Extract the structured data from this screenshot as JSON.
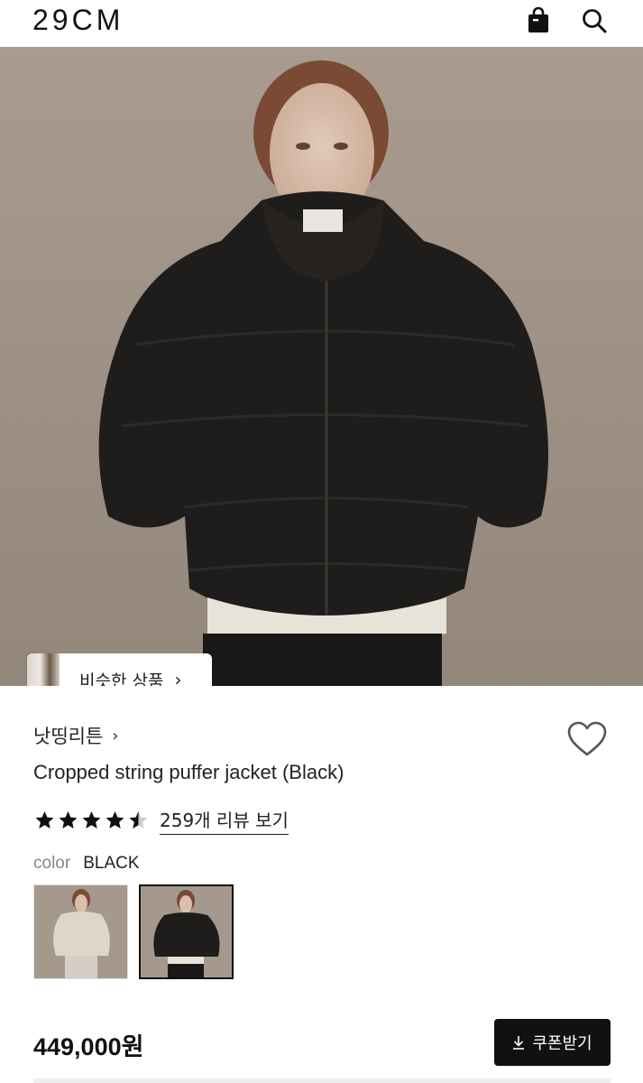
{
  "header": {
    "logo": "29CM",
    "icons": [
      "shopping-bag-icon",
      "search-icon"
    ]
  },
  "hero": {
    "similar_button_label": "비슷한 상품",
    "similar_chevron": "›"
  },
  "product": {
    "brand": "낫띵리튼",
    "brand_chevron": "›",
    "title": "Cropped string puffer jacket (Black)",
    "rating": 4.5,
    "review_link": "259개 리뷰 보기",
    "color_label": "color",
    "color_value": "BLACK",
    "swatches": [
      {
        "name": "cream",
        "selected": false
      },
      {
        "name": "black",
        "selected": true
      }
    ],
    "price": "449,000원",
    "coupon_label": "쿠폰받기"
  },
  "colors": {
    "primary": "#111111",
    "text": "#222222",
    "muted": "#888888",
    "star": "#111111"
  }
}
